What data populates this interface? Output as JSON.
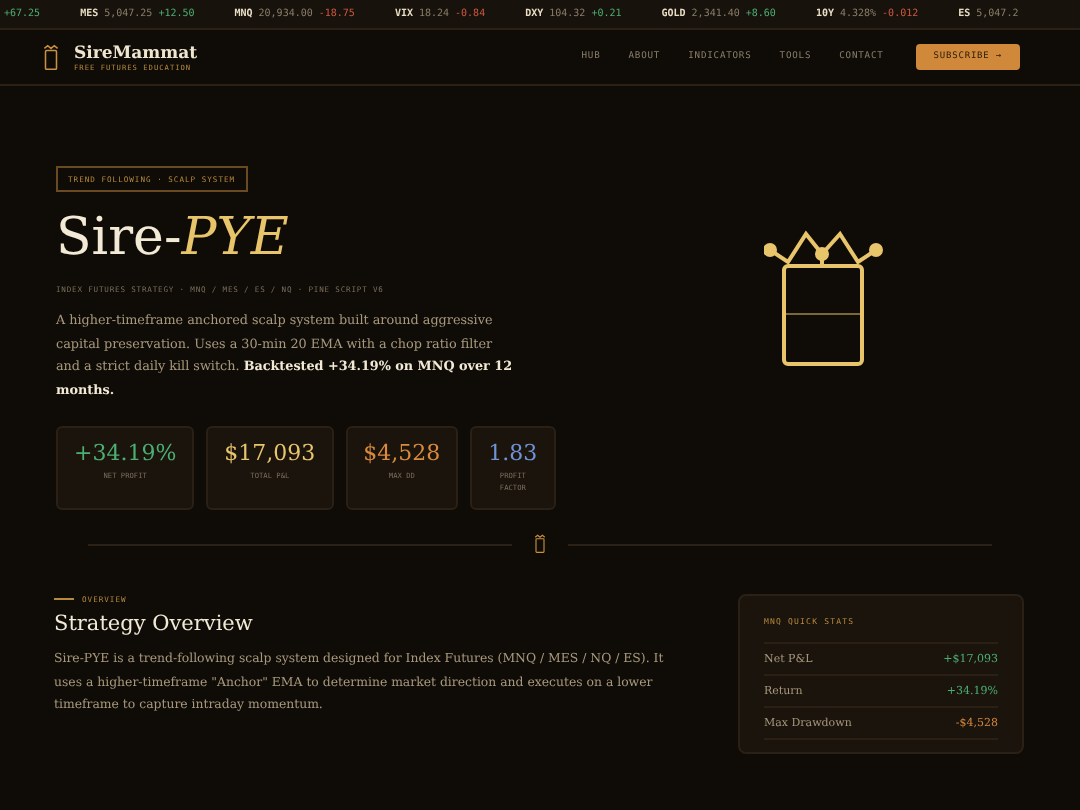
{
  "ticker": [
    {
      "change": "+67.25",
      "up": true
    },
    {
      "symbol": "MES",
      "price": "5,047.25",
      "change": "+12.50",
      "up": true
    },
    {
      "symbol": "MNQ",
      "price": "20,934.00",
      "change": "-18.75",
      "up": false
    },
    {
      "symbol": "VIX",
      "price": "18.24",
      "change": "-0.84",
      "up": false
    },
    {
      "symbol": "DXY",
      "price": "104.32",
      "change": "+0.21",
      "up": true
    },
    {
      "symbol": "GOLD",
      "price": "2,341.40",
      "change": "+8.60",
      "up": true
    },
    {
      "symbol": "10Y",
      "price": "4.328%",
      "change": "-0.012",
      "up": false
    },
    {
      "symbol": "ES",
      "price": "5,047.2"
    }
  ],
  "brand": {
    "name": "SireMammat",
    "tagline": "FREE FUTURES EDUCATION"
  },
  "nav": {
    "links": [
      "HUB",
      "ABOUT",
      "INDICATORS",
      "TOOLS",
      "CONTACT"
    ],
    "cta": "SUBSCRIBE →"
  },
  "hero": {
    "badge": "TREND FOLLOWING · SCALP SYSTEM",
    "title_plain": "Sire-",
    "title_accent": "PYE",
    "subtitle": "INDEX FUTURES STRATEGY · MNQ / MES / ES / NQ · PINE SCRIPT V6",
    "description": "A higher-timeframe anchored scalp system built around aggressive capital preservation. Uses a 30-min 20 EMA with a chop ratio filter and a strict daily kill switch. **Backtested +34.19% on MNQ over 12 months.**",
    "stats": [
      {
        "value": "+34.19%",
        "label": "NET PROFIT",
        "color": "#4caf72"
      },
      {
        "value": "$17,093",
        "label": "TOTAL P&L",
        "color": "#e8c46a"
      },
      {
        "value": "$4,528",
        "label": "MAX DD",
        "color": "#d98a3c"
      },
      {
        "value": "1.83",
        "label": "PROFIT FACTOR",
        "color": "#6f93d6"
      }
    ]
  },
  "overview": {
    "eyebrow": "OVERVIEW",
    "heading": "Strategy Overview",
    "body": "Sire-PYE is a trend-following scalp system designed for Index Futures (MNQ / MES / NQ / ES). It uses a higher-timeframe \"Anchor\" EMA to determine market direction and executes on a lower timeframe to capture intraday momentum."
  },
  "quick_stats": {
    "title": "MNQ QUICK STATS",
    "rows": [
      {
        "label": "Net P&L",
        "value": "+$17,093",
        "up": true
      },
      {
        "label": "Return",
        "value": "+34.19%",
        "up": true
      },
      {
        "label": "Max Drawdown",
        "value": "-$4,528",
        "up": false
      }
    ]
  }
}
